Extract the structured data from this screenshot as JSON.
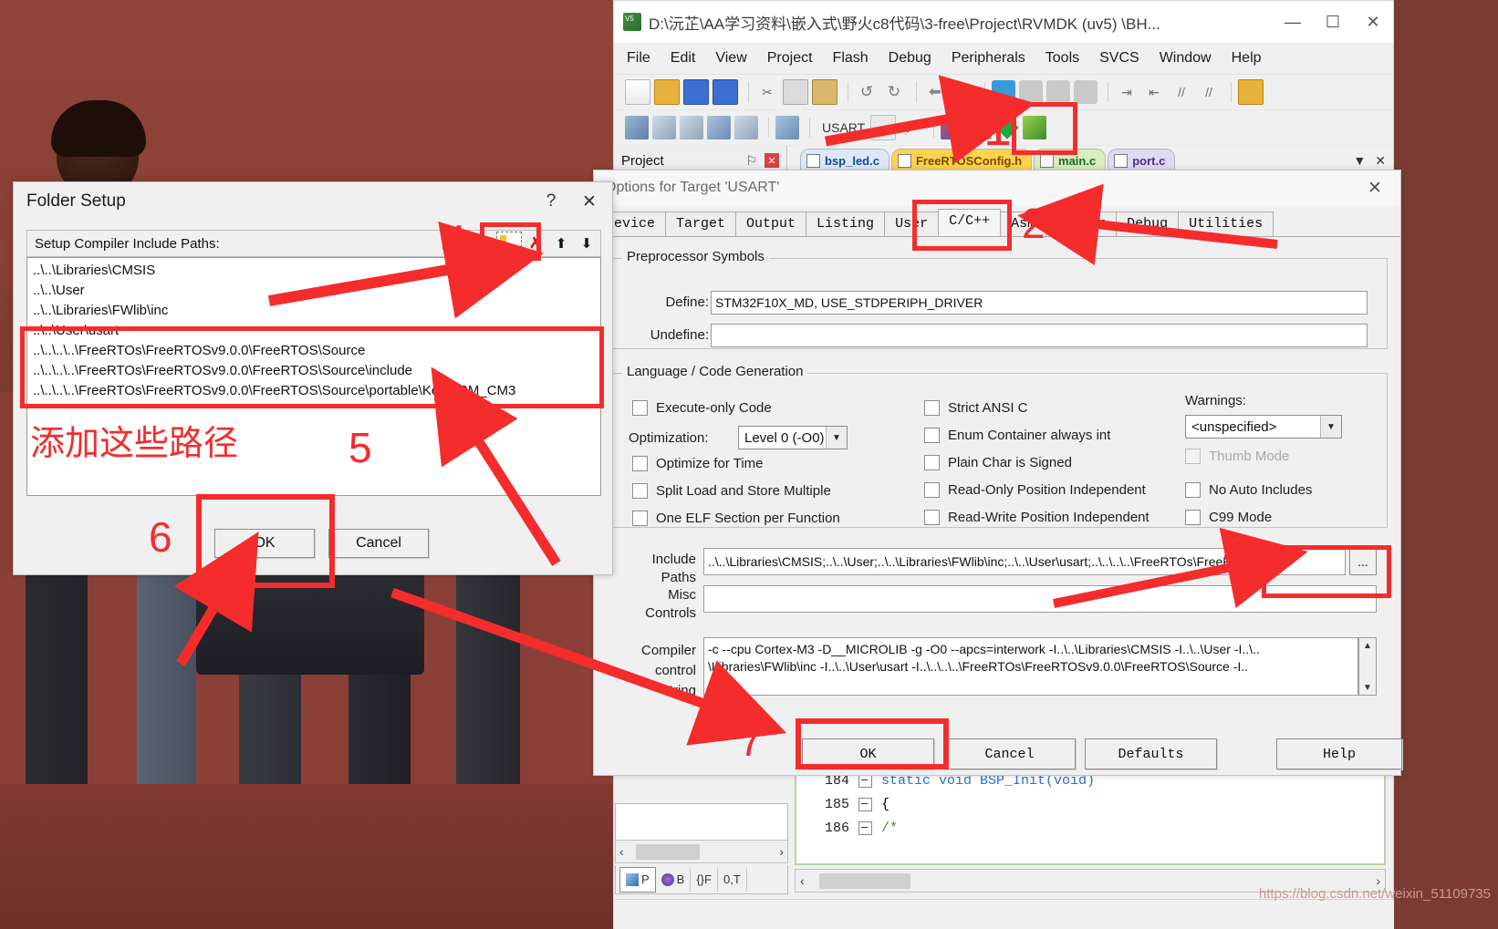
{
  "keil": {
    "title": "D:\\沅芷\\AA学习资料\\嵌入式\\野火c8代码\\3-free\\Project\\RVMDK (uv5) \\BH...",
    "window_buttons": {
      "minimize": "—",
      "maximize": "☐",
      "close": "✕"
    },
    "menu": [
      "File",
      "Edit",
      "View",
      "Project",
      "Flash",
      "Debug",
      "Peripherals",
      "Tools",
      "SVCS",
      "Window",
      "Help"
    ],
    "target_selector": "USART",
    "project_panel": {
      "title": "Project",
      "pin": "⚐",
      "close": "✕"
    },
    "file_tabs": [
      {
        "label": "bsp_led.c",
        "color": "blue"
      },
      {
        "label": "FreeRTOSConfig.h",
        "color": "yellow"
      },
      {
        "label": "main.c",
        "color": "green"
      },
      {
        "label": "port.c",
        "color": "purple"
      }
    ],
    "tab_controls": {
      "overflow": "▼",
      "close": "✕"
    },
    "project_tabs": [
      {
        "label": "P",
        "icon": "project-icon"
      },
      {
        "label": "B",
        "icon": "books-icon"
      },
      {
        "label": "F",
        "icon": "functions-icon"
      },
      {
        "label": "T",
        "icon": "templates-icon"
      }
    ],
    "editor_lines": [
      {
        "num": "184",
        "text": "static void BSP_Init(void)"
      },
      {
        "num": "185",
        "text": "{"
      },
      {
        "num": "186",
        "text": "/*"
      }
    ],
    "scroll_left": "‹",
    "scroll_right": "›",
    "scroll_down": "⌄",
    "watermark": "https://blog.csdn.net/weixin_51109735"
  },
  "options_dialog": {
    "title": "Options for Target 'USART'",
    "close": "✕",
    "tabs": [
      {
        "label": "evice",
        "active": false
      },
      {
        "label": "Target",
        "active": false
      },
      {
        "label": "Output",
        "active": false
      },
      {
        "label": "Listing",
        "active": false
      },
      {
        "label": "User",
        "active": false
      },
      {
        "label": "C/C++",
        "active": true
      },
      {
        "label": "Asm",
        "active": false
      },
      {
        "label": "Linker",
        "active": false
      },
      {
        "label": "Debug",
        "active": false
      },
      {
        "label": "Utilities",
        "active": false
      }
    ],
    "preprocessor": {
      "legend": "Preprocessor Symbols",
      "define_label": "Define:",
      "define_value": "STM32F10X_MD, USE_STDPERIPH_DRIVER",
      "undefine_label": "Undefine:",
      "undefine_value": ""
    },
    "language": {
      "legend": "Language / Code Generation",
      "left_checks": [
        {
          "label": "Execute-only Code",
          "checked": false,
          "disabled": false
        },
        {
          "label": "Optimize for Time",
          "checked": false,
          "disabled": false
        },
        {
          "label": "Split Load and Store Multiple",
          "checked": false,
          "disabled": false
        },
        {
          "label": "One ELF Section per Function",
          "checked": false,
          "disabled": false
        }
      ],
      "optimization_label": "Optimization:",
      "optimization_value": "Level 0 (-O0)",
      "mid_checks": [
        {
          "label": "Strict ANSI C",
          "checked": false,
          "disabled": false
        },
        {
          "label": "Enum Container always int",
          "checked": false,
          "disabled": false
        },
        {
          "label": "Plain Char is Signed",
          "checked": false,
          "disabled": false
        },
        {
          "label": "Read-Only Position Independent",
          "checked": false,
          "disabled": false
        },
        {
          "label": "Read-Write Position Independent",
          "checked": false,
          "disabled": false
        }
      ],
      "warnings_label": "Warnings:",
      "warnings_value": "<unspecified>",
      "right_checks": [
        {
          "label": "Thumb Mode",
          "checked": false,
          "disabled": true
        },
        {
          "label": "No Auto Includes",
          "checked": false,
          "disabled": false
        },
        {
          "label": "C99 Mode",
          "checked": false,
          "disabled": false
        }
      ]
    },
    "include_paths_label_1": "Include",
    "include_paths_label_2": "Paths",
    "include_paths_value": "..\\..\\Libraries\\CMSIS;..\\..\\User;..\\..\\Libraries\\FWlib\\inc;..\\..\\User\\usart;..\\..\\..\\..\\FreeRTOs\\FreeRTO",
    "include_browse_button": "...",
    "misc_label_1": "Misc",
    "misc_label_2": "Controls",
    "misc_value": "",
    "compiler_label_1": "Compiler",
    "compiler_label_2": "control",
    "compiler_label_3": "string",
    "compiler_lines": [
      "-c --cpu Cortex-M3 -D__MICROLIB -g -O0 --apcs=interwork -I..\\..\\Libraries\\CMSIS -I..\\..\\User -I..\\..",
      "\\Libraries\\FWlib\\inc -I..\\..\\User\\usart -I..\\..\\..\\..\\FreeRTOs\\FreeRTOSv9.0.0\\FreeRTOS\\Source -I.."
    ],
    "scroll_up": "▲",
    "scroll_down": "▼",
    "buttons": [
      {
        "label": "OK",
        "name": "ok-button"
      },
      {
        "label": "Cancel",
        "name": "cancel-button"
      },
      {
        "label": "Defaults",
        "name": "defaults-button"
      },
      {
        "label": "Help",
        "name": "help-button"
      }
    ]
  },
  "folder_dialog": {
    "title": "Folder Setup",
    "help_btn": "?",
    "close_btn": "✕",
    "bar_label": "Setup Compiler Include Paths:",
    "toolbar_icons": [
      "new-folder-icon",
      "delete-icon",
      "move-up-icon",
      "move-down-icon"
    ],
    "existing_paths": [
      "..\\..\\Libraries\\CMSIS",
      "..\\..\\User",
      "..\\..\\Libraries\\FWlib\\inc",
      "..\\..\\User\\usart"
    ],
    "new_paths": [
      "..\\..\\..\\..\\FreeRTOs\\FreeRTOSv9.0.0\\FreeRTOS\\Source",
      "..\\..\\..\\..\\FreeRTOs\\FreeRTOSv9.0.0\\FreeRTOS\\Source\\include",
      "..\\..\\..\\..\\FreeRTOs\\FreeRTOSv9.0.0\\FreeRTOS\\Source\\portable\\Keil\\ARM_CM3"
    ],
    "note_cn": "添加这些路径",
    "ok_label": "OK",
    "cancel_label": "Cancel"
  },
  "annotations": {
    "numbers": [
      "1",
      "2",
      "3",
      "4",
      "5",
      "6",
      "7"
    ],
    "color": "#f52c2c"
  }
}
